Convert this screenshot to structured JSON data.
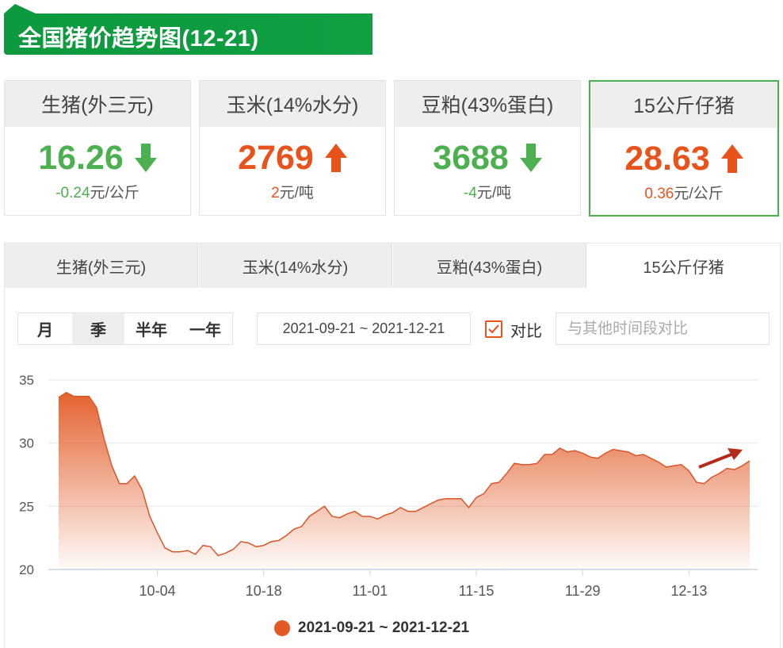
{
  "title": "全国猪价趋势图(12-21)",
  "cards": [
    {
      "name": "生猪(外三元)",
      "value": "16.26",
      "trend": "down",
      "change": "-0.24",
      "unit": "元/公斤",
      "color": "#4caf50"
    },
    {
      "name": "玉米(14%水分)",
      "value": "2769",
      "trend": "up",
      "change": "2",
      "unit": "元/吨",
      "color": "#e8531c"
    },
    {
      "name": "豆粕(43%蛋白)",
      "value": "3688",
      "trend": "down",
      "change": "-4",
      "unit": "元/吨",
      "color": "#4caf50"
    },
    {
      "name": "15公斤仔猪",
      "value": "28.63",
      "trend": "up",
      "change": "0.36",
      "unit": "元/公斤",
      "color": "#e8531c"
    }
  ],
  "tabs": [
    "生猪(外三元)",
    "玉米(14%水分)",
    "豆粕(43%蛋白)",
    "15公斤仔猪"
  ],
  "active_tab": 3,
  "periods": [
    "月",
    "季",
    "半年",
    "一年"
  ],
  "active_period": 1,
  "date_range": "2021-09-21 ~ 2021-12-21",
  "compare_label": "对比",
  "compare_checked": true,
  "compare_placeholder": "与其他时间段对比",
  "colors": {
    "accent": "#e8531c",
    "green": "#4caf50",
    "banner": "#0d9a3e",
    "series": "#e25a25"
  },
  "chart_data": {
    "type": "area",
    "ylim": [
      20,
      35
    ],
    "yticks": [
      20,
      25,
      30,
      35
    ],
    "xticks": [
      "10-04",
      "10-18",
      "11-01",
      "11-15",
      "11-29",
      "12-13"
    ],
    "series": [
      {
        "name": "2021-09-21 ~ 2021-12-21",
        "x": [
          "09-21",
          "09-22",
          "09-23",
          "09-24",
          "09-25",
          "09-26",
          "09-27",
          "09-28",
          "09-29",
          "09-30",
          "10-01",
          "10-02",
          "10-03",
          "10-04",
          "10-05",
          "10-06",
          "10-07",
          "10-08",
          "10-09",
          "10-10",
          "10-11",
          "10-12",
          "10-13",
          "10-14",
          "10-15",
          "10-16",
          "10-17",
          "10-18",
          "10-19",
          "10-20",
          "10-21",
          "10-22",
          "10-23",
          "10-24",
          "10-25",
          "10-26",
          "10-27",
          "10-28",
          "10-29",
          "10-30",
          "10-31",
          "11-01",
          "11-02",
          "11-03",
          "11-04",
          "11-05",
          "11-06",
          "11-07",
          "11-08",
          "11-09",
          "11-10",
          "11-11",
          "11-12",
          "11-13",
          "11-14",
          "11-15",
          "11-16",
          "11-17",
          "11-18",
          "11-19",
          "11-20",
          "11-21",
          "11-22",
          "11-23",
          "11-24",
          "11-25",
          "11-26",
          "11-27",
          "11-28",
          "11-29",
          "11-30",
          "12-01",
          "12-02",
          "12-03",
          "12-04",
          "12-05",
          "12-06",
          "12-07",
          "12-08",
          "12-09",
          "12-10",
          "12-11",
          "12-12",
          "12-13",
          "12-14",
          "12-15",
          "12-16",
          "12-17",
          "12-18",
          "12-19",
          "12-20",
          "12-21"
        ],
        "values": [
          33.6,
          34.0,
          33.7,
          33.7,
          33.7,
          32.8,
          30.3,
          28.2,
          26.8,
          26.8,
          27.4,
          26.3,
          24.2,
          22.9,
          21.7,
          21.4,
          21.4,
          21.5,
          21.2,
          21.9,
          21.8,
          21.1,
          21.3,
          21.6,
          22.2,
          22.1,
          21.8,
          21.9,
          22.2,
          22.3,
          22.7,
          23.2,
          23.4,
          24.2,
          24.6,
          25.0,
          24.2,
          24.1,
          24.4,
          24.6,
          24.2,
          24.2,
          24.0,
          24.3,
          24.5,
          24.9,
          24.6,
          24.6,
          24.9,
          25.2,
          25.5,
          25.6,
          25.6,
          25.6,
          24.9,
          25.7,
          26.0,
          26.8,
          26.9,
          27.6,
          28.4,
          28.3,
          28.3,
          28.4,
          29.1,
          29.1,
          29.6,
          29.3,
          29.4,
          29.2,
          28.9,
          28.8,
          29.2,
          29.5,
          29.4,
          29.3,
          29.0,
          29.1,
          28.8,
          28.5,
          28.1,
          28.2,
          28.3,
          27.8,
          26.9,
          26.8,
          27.3,
          27.6,
          28.0,
          27.9,
          28.2,
          28.6
        ]
      }
    ]
  }
}
